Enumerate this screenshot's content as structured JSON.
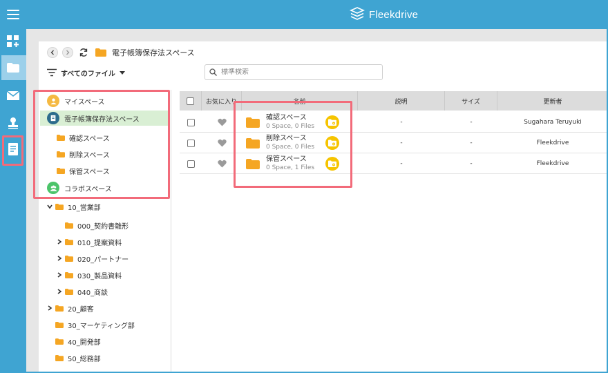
{
  "app": {
    "title": "Fleekdrive"
  },
  "colors": {
    "brand": "#3fa4d2",
    "folder": "#f5a623",
    "highlight": "#f26b7a",
    "selected_row": "#d9efd4",
    "space_badge": "#f6c400"
  },
  "rail": {
    "items": [
      {
        "icon": "dashboard-add-icon"
      },
      {
        "icon": "folder-icon",
        "active": true
      },
      {
        "icon": "mail-icon"
      },
      {
        "icon": "stamp-icon"
      },
      {
        "icon": "document-list-icon"
      }
    ]
  },
  "breadcrumb": {
    "current": "電子帳簿保存法スペース"
  },
  "filter": {
    "label": "すべてのファイル"
  },
  "search": {
    "placeholder": "標準検索"
  },
  "tree": {
    "roots": [
      {
        "label": "マイスペース",
        "icon": "person-icon"
      },
      {
        "label": "電子帳簿保存法スペース",
        "icon": "ledger-icon"
      },
      {
        "label": "コラボスペース",
        "icon": "group-icon"
      }
    ],
    "ledger_children": [
      "確認スペース",
      "削除スペース",
      "保管スペース"
    ],
    "collab_children": [
      "10_営業部",
      "000_契約書雛形",
      "010_提案資料",
      "020_パートナー",
      "030_製品資料",
      "040_商談",
      "20_顧客",
      "30_マーケティング部",
      "40_開発部",
      "50_総務部"
    ]
  },
  "table": {
    "headers": {
      "favorite": "お気に入り",
      "name": "名前",
      "description": "説明",
      "size": "サイズ",
      "updater": "更新者"
    },
    "rows": [
      {
        "name": "確認スペース",
        "meta": "0 Space, 0 Files",
        "description": "-",
        "size": "-",
        "updater": "Sugahara Teruyuki"
      },
      {
        "name": "削除スペース",
        "meta": "0 Space, 0 Files",
        "description": "-",
        "size": "-",
        "updater": "Fleekdrive"
      },
      {
        "name": "保管スペース",
        "meta": "0 Space, 1 Files",
        "description": "-",
        "size": "-",
        "updater": "Fleekdrive"
      }
    ]
  }
}
